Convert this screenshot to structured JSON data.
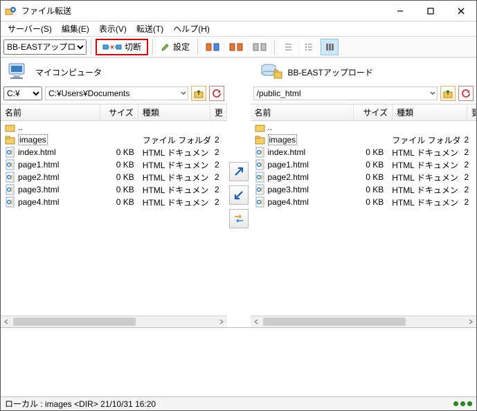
{
  "title": "ファイル転送",
  "menubar": [
    {
      "label": "サーバー(S)"
    },
    {
      "label": "編集(E)"
    },
    {
      "label": "表示(V)"
    },
    {
      "label": "転送(T)"
    },
    {
      "label": "ヘルプ(H)"
    }
  ],
  "toolbar": {
    "site_value": "BB-EASTアップロ",
    "disconnect_label": "切断",
    "settings_label": "設定"
  },
  "local": {
    "title": "マイコンピュータ",
    "drive": "C:¥",
    "path": "C:¥Users¥Documents",
    "columns": {
      "name": "名前",
      "size": "サイズ",
      "type": "種類",
      "date": "更"
    },
    "parent": "..",
    "rows": [
      {
        "icon": "folder",
        "name": "images",
        "selected": true,
        "size": "",
        "type": "ファイル フォルダー",
        "date": "2"
      },
      {
        "icon": "html",
        "name": "index.html",
        "selected": false,
        "size": "0 KB",
        "type": "HTML ドキュメント",
        "date": "2"
      },
      {
        "icon": "html",
        "name": "page1.html",
        "selected": false,
        "size": "0 KB",
        "type": "HTML ドキュメント",
        "date": "2"
      },
      {
        "icon": "html",
        "name": "page2.html",
        "selected": false,
        "size": "0 KB",
        "type": "HTML ドキュメント",
        "date": "2"
      },
      {
        "icon": "html",
        "name": "page3.html",
        "selected": false,
        "size": "0 KB",
        "type": "HTML ドキュメント",
        "date": "2"
      },
      {
        "icon": "html",
        "name": "page4.html",
        "selected": false,
        "size": "0 KB",
        "type": "HTML ドキュメント",
        "date": "2"
      }
    ]
  },
  "remote": {
    "title": "BB-EASTアップロード",
    "path": "/public_html",
    "columns": {
      "name": "名前",
      "size": "サイズ",
      "type": "種類",
      "date": "更新日時"
    },
    "parent": "..",
    "rows": [
      {
        "icon": "folder",
        "name": "images",
        "selected": true,
        "size": "",
        "type": "ファイル フォルダー",
        "date": "2"
      },
      {
        "icon": "html",
        "name": "index.html",
        "selected": false,
        "size": "0 KB",
        "type": "HTML ドキュメント",
        "date": "2"
      },
      {
        "icon": "html",
        "name": "page1.html",
        "selected": false,
        "size": "0 KB",
        "type": "HTML ドキュメント",
        "date": "2"
      },
      {
        "icon": "html",
        "name": "page2.html",
        "selected": false,
        "size": "0 KB",
        "type": "HTML ドキュメント",
        "date": "2"
      },
      {
        "icon": "html",
        "name": "page3.html",
        "selected": false,
        "size": "0 KB",
        "type": "HTML ドキュメント",
        "date": "2"
      },
      {
        "icon": "html",
        "name": "page4.html",
        "selected": false,
        "size": "0 KB",
        "type": "HTML ドキュメント",
        "date": "2"
      }
    ]
  },
  "statusbar": "ローカル : images <DIR> 21/10/31 16:20"
}
